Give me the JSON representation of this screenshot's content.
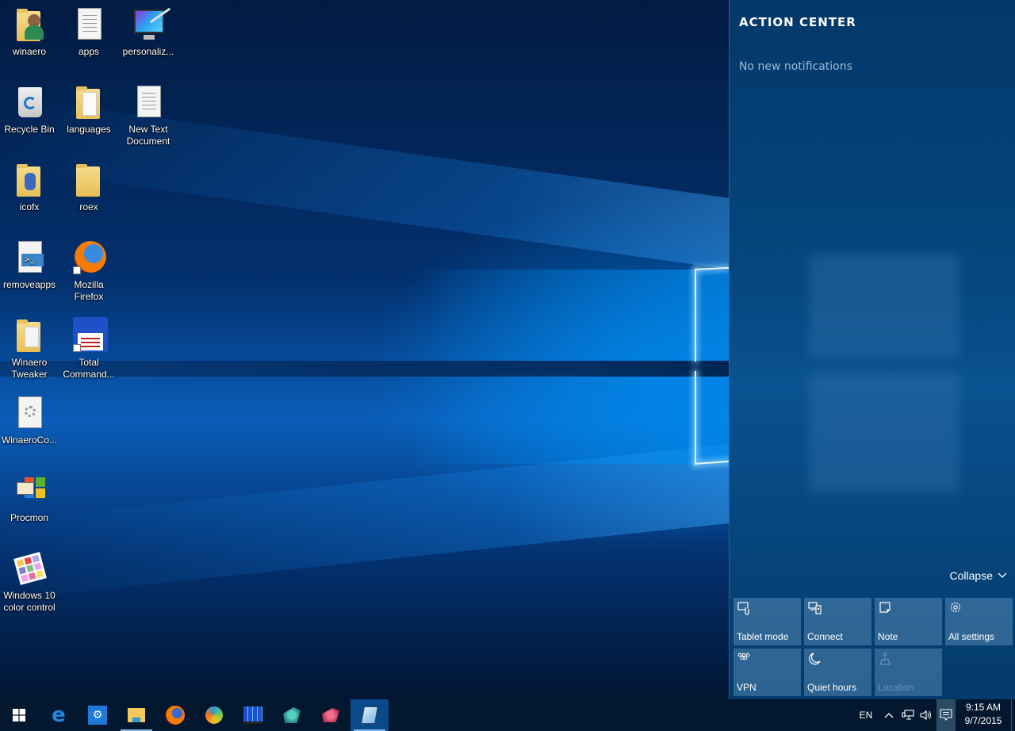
{
  "desktop": {
    "icons": [
      {
        "label": "winaero",
        "icon": "user-folder-icon"
      },
      {
        "label": "apps",
        "icon": "text-document-icon"
      },
      {
        "label": "personaliz...",
        "icon": "personalize-monitor-icon"
      },
      {
        "label": "Recycle Bin",
        "icon": "recycle-bin-icon"
      },
      {
        "label": "languages",
        "icon": "folder-icon"
      },
      {
        "label": "New Text Document",
        "icon": "text-document-icon"
      },
      {
        "label": "icofx",
        "icon": "folder-icon"
      },
      {
        "label": "roex",
        "icon": "folder-icon"
      },
      {
        "label": "removeapps",
        "icon": "powershell-script-icon"
      },
      {
        "label": "Mozilla Firefox",
        "icon": "firefox-icon"
      },
      {
        "label": "Winaero Tweaker",
        "icon": "folder-icon"
      },
      {
        "label": "Total Command...",
        "icon": "total-commander-icon"
      },
      {
        "label": "WinaeroCo...",
        "icon": "config-file-icon"
      },
      {
        "label": "Procmon",
        "icon": "procmon-icon"
      },
      {
        "label": "Windows 10 color control",
        "icon": "color-control-icon"
      }
    ]
  },
  "action_center": {
    "title": "ACTION CENTER",
    "empty_text": "No new notifications",
    "collapse_label": "Collapse",
    "tiles": [
      {
        "label": "Tablet mode",
        "icon": "tablet-mode-icon",
        "enabled": true
      },
      {
        "label": "Connect",
        "icon": "connect-icon",
        "enabled": true
      },
      {
        "label": "Note",
        "icon": "note-icon",
        "enabled": true
      },
      {
        "label": "All settings",
        "icon": "settings-gear-icon",
        "enabled": true
      },
      {
        "label": "VPN",
        "icon": "vpn-icon",
        "enabled": true
      },
      {
        "label": "Quiet hours",
        "icon": "moon-icon",
        "enabled": true
      },
      {
        "label": "Location",
        "icon": "location-icon",
        "enabled": false
      }
    ]
  },
  "taskbar": {
    "apps": [
      {
        "name": "start",
        "icon": "windows-logo-icon"
      },
      {
        "name": "edge",
        "icon": "edge-icon"
      },
      {
        "name": "settings",
        "icon": "settings-icon"
      },
      {
        "name": "file-explorer",
        "icon": "file-explorer-icon",
        "running": true
      },
      {
        "name": "firefox",
        "icon": "firefox-icon"
      },
      {
        "name": "app-swirl",
        "icon": "swirl-app-icon"
      },
      {
        "name": "total-commander",
        "icon": "total-commander-icon"
      },
      {
        "name": "registry-editor",
        "icon": "registry-editor-icon"
      },
      {
        "name": "app-cubes",
        "icon": "cubes-app-icon"
      },
      {
        "name": "notepad",
        "icon": "notepad-icon",
        "active": true
      }
    ],
    "tray": {
      "language": "EN",
      "time": "9:15 AM",
      "date": "9/7/2015"
    }
  }
}
